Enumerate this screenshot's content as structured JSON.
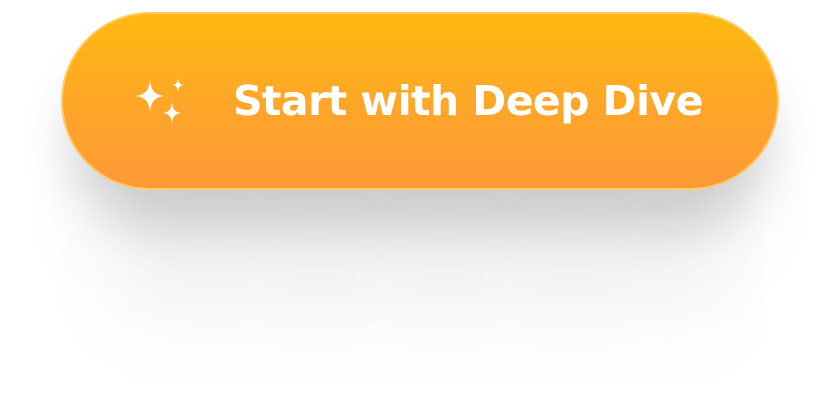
{
  "button": {
    "label": "Start with Deep Dive",
    "icon": "sparkles-icon",
    "colors": {
      "gradient_top": "#ffb90f",
      "gradient_bottom": "#fd9a35",
      "border": "#ffd678",
      "text": "#ffffff"
    }
  }
}
